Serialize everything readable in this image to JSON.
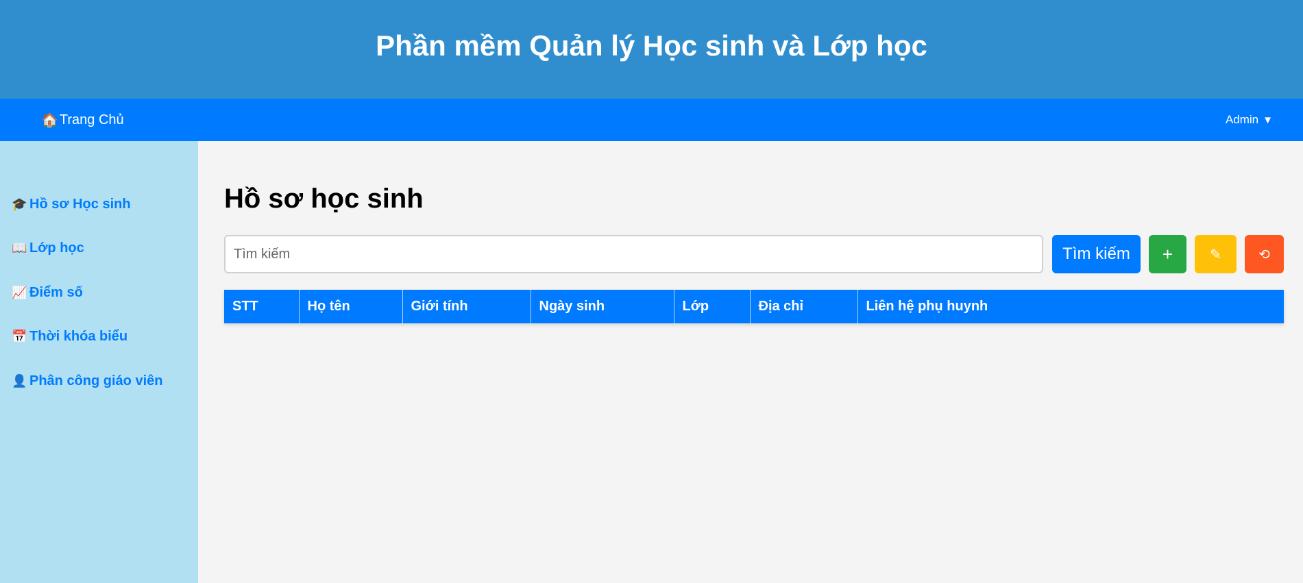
{
  "header": {
    "title": "Phần mềm Quản lý Học sinh và Lớp học"
  },
  "navbar": {
    "home_icon": "🏠",
    "home_label": "Trang Chủ",
    "user_label": "Admin",
    "user_caret": "▼"
  },
  "sidebar": {
    "items": [
      {
        "icon": "🎓",
        "icon_name": "graduation-cap-icon",
        "label": "Hồ sơ Học sinh"
      },
      {
        "icon": "📖",
        "icon_name": "open-book-icon",
        "label": "Lớp học"
      },
      {
        "icon": "📈",
        "icon_name": "chart-increasing-icon",
        "label": "Điểm số"
      },
      {
        "icon": "📅",
        "icon_name": "calendar-icon",
        "label": "Thời khóa biểu"
      },
      {
        "icon": "👤",
        "icon_name": "person-icon",
        "label": "Phân công giáo viên"
      }
    ]
  },
  "main": {
    "title": "Hồ sơ học sinh",
    "search": {
      "placeholder": "Tìm kiếm",
      "value": ""
    },
    "buttons": {
      "search_label": "Tìm kiếm",
      "add_icon": "+",
      "edit_icon": "✎",
      "reset_icon": "⟲"
    },
    "table": {
      "columns": [
        "STT",
        "Họ tên",
        "Giới tính",
        "Ngày sinh",
        "Lớp",
        "Địa chỉ",
        "Liên hệ phụ huynh"
      ],
      "rows": []
    }
  },
  "colors": {
    "header_bg": "#308ecf",
    "navbar_bg": "#007bff",
    "sidebar_bg": "#b1e0f2",
    "accent": "#007bff",
    "add": "#28a745",
    "edit": "#ffc107",
    "reset": "#ff5722"
  }
}
